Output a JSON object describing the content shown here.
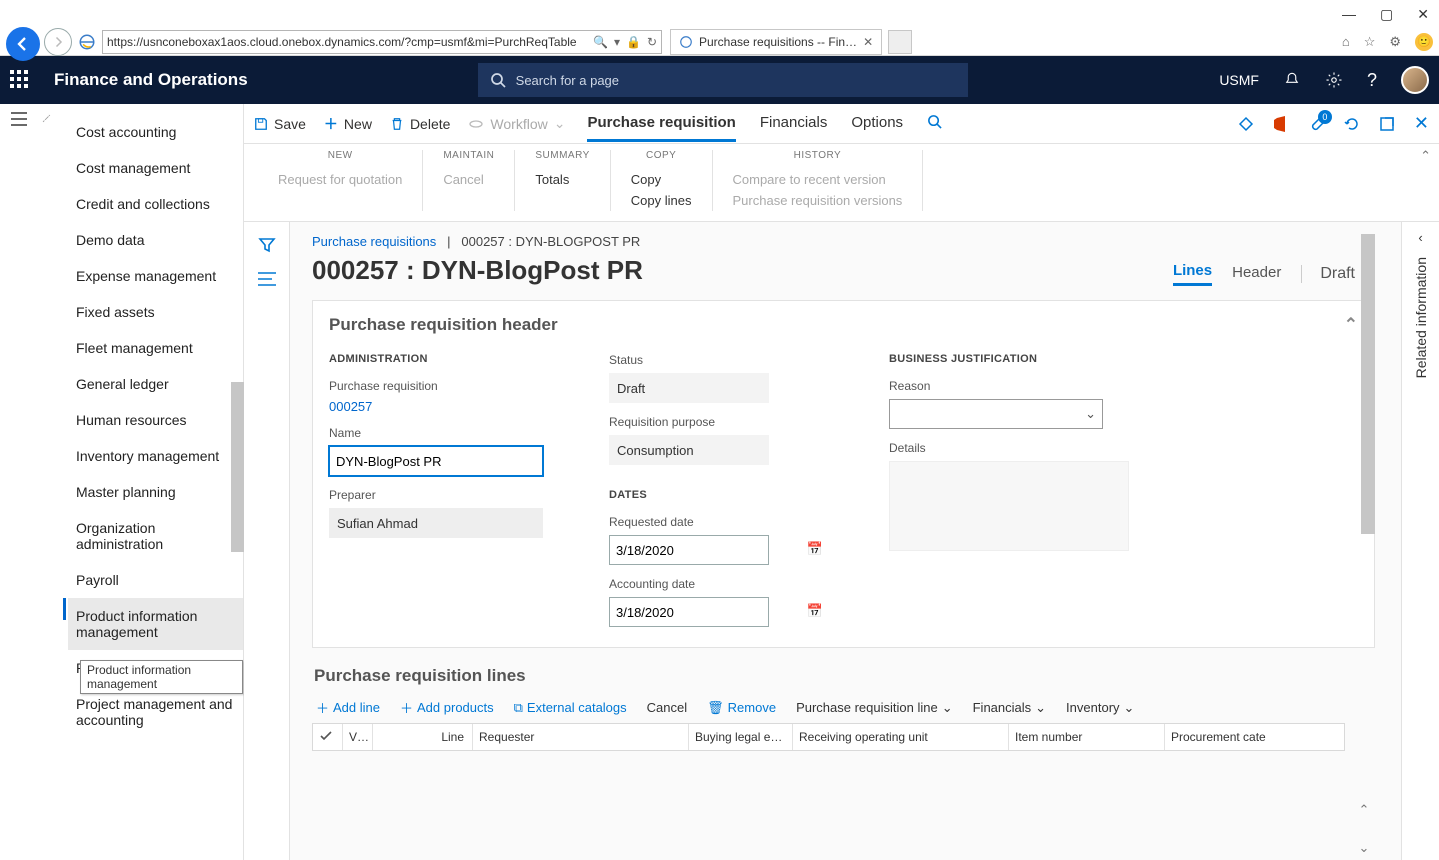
{
  "window": {
    "min": "—",
    "max": "▢",
    "close": "✕"
  },
  "browser": {
    "url": "https://usnconeboxax1aos.cloud.onebox.dynamics.com/?cmp=usmf&mi=PurchReqTable",
    "tab_title": "Purchase requisitions -- Fin…"
  },
  "header": {
    "brand": "Finance and Operations",
    "search_placeholder": "Search for a page",
    "company": "USMF"
  },
  "nav": {
    "items": [
      "Cost accounting",
      "Cost management",
      "Credit and collections",
      "Demo data",
      "Expense management",
      "Fixed assets",
      "Fleet management",
      "General ledger",
      "Human resources",
      "Inventory management",
      "Master planning",
      "Organization administration",
      "Payroll",
      "Product information management",
      "Production control",
      "Project management and accounting"
    ],
    "tooltip": "Product information management"
  },
  "actionbar": {
    "save": "Save",
    "new": "New",
    "delete": "Delete",
    "workflow": "Workflow",
    "tabs": [
      "Purchase requisition",
      "Financials",
      "Options"
    ]
  },
  "ribbon": {
    "groups": [
      {
        "title": "NEW",
        "items": [
          {
            "text": "Request for quotation",
            "muted": true
          }
        ]
      },
      {
        "title": "MAINTAIN",
        "items": [
          {
            "text": "Cancel",
            "muted": true
          }
        ]
      },
      {
        "title": "SUMMARY",
        "items": [
          {
            "text": "Totals"
          }
        ]
      },
      {
        "title": "COPY",
        "items": [
          {
            "text": "Copy"
          },
          {
            "text": "Copy lines"
          }
        ]
      },
      {
        "title": "HISTORY",
        "items": [
          {
            "text": "Compare to recent version",
            "muted": true
          },
          {
            "text": "Purchase requisition versions",
            "muted": true
          }
        ]
      }
    ]
  },
  "crumbs": {
    "root": "Purchase requisitions",
    "sep": "|",
    "leaf": "000257 : DYN-BLOGPOST PR"
  },
  "page": {
    "title": "000257 : DYN-BlogPost PR",
    "views": [
      "Lines",
      "Header"
    ],
    "status": "Draft"
  },
  "card1": {
    "title": "Purchase requisition header",
    "admin_label": "ADMINISTRATION",
    "pr_label": "Purchase requisition",
    "pr_value": "000257",
    "name_label": "Name",
    "name_value": "DYN-BlogPost PR",
    "preparer_label": "Preparer",
    "preparer_value": "Sufian Ahmad",
    "status_label": "Status",
    "status_value": "Draft",
    "purpose_label": "Requisition purpose",
    "purpose_value": "Consumption",
    "dates_label": "DATES",
    "reqdate_label": "Requested date",
    "reqdate_value": "3/18/2020",
    "accdate_label": "Accounting date",
    "accdate_value": "3/18/2020",
    "bj_label": "BUSINESS JUSTIFICATION",
    "reason_label": "Reason",
    "details_label": "Details"
  },
  "card2": {
    "title": "Purchase requisition lines",
    "tools": {
      "add_line": "Add line",
      "add_products": "Add products",
      "external": "External catalogs",
      "cancel": "Cancel",
      "remove": "Remove",
      "pr_line": "Purchase requisition line",
      "financials": "Financials",
      "inventory": "Inventory"
    },
    "columns": [
      "",
      "V…",
      "Line",
      "Requester",
      "Buying legal en…",
      "Receiving operating unit",
      "Item number",
      "Procurement cate"
    ]
  },
  "rail": {
    "label": "Related information"
  }
}
